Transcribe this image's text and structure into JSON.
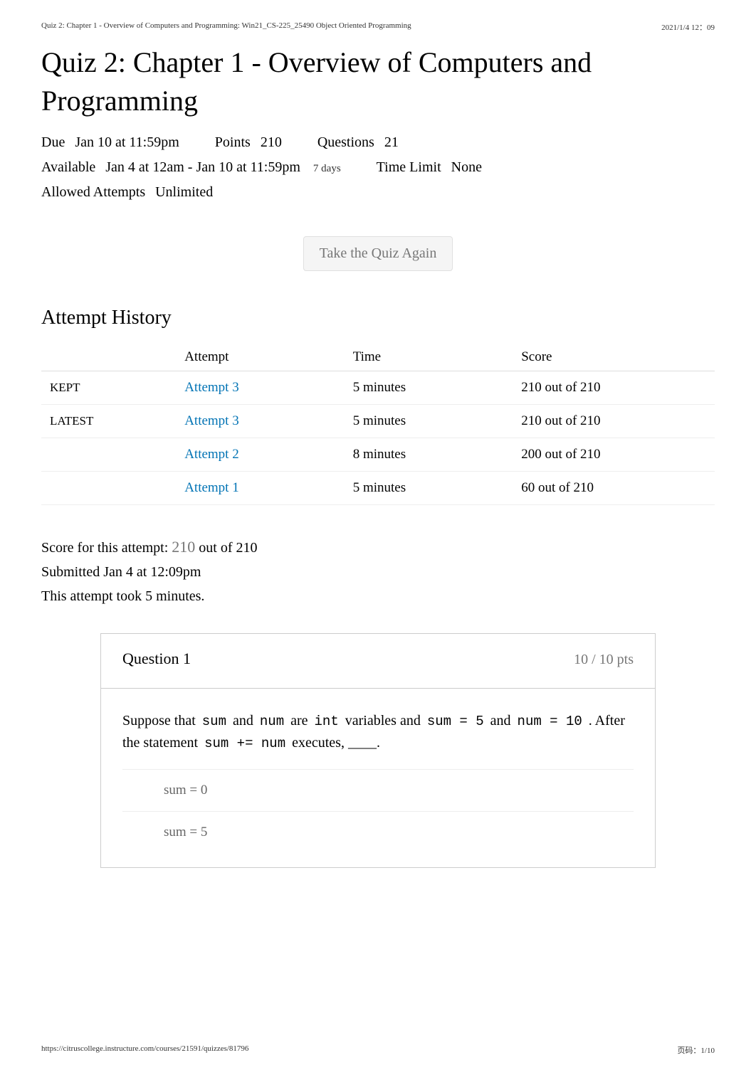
{
  "print_header": {
    "left": "Quiz 2: Chapter 1 - Overview of Computers and Programming: Win21_CS-225_25490 Object Oriented Programming",
    "right": "2021/1/4 12：09"
  },
  "title": "Quiz 2: Chapter 1 - Overview of Computers and Programming",
  "meta": {
    "due": {
      "label": "Due",
      "value": "Jan 10 at 11:59pm"
    },
    "points": {
      "label": "Points",
      "value": "210"
    },
    "questions": {
      "label": "Questions",
      "value": "21"
    },
    "available": {
      "label": "Available",
      "value": "Jan 4 at 12am - Jan 10 at 11:59pm",
      "aside": "7 days"
    },
    "time_limit": {
      "label": "Time Limit",
      "value": "None"
    },
    "allowed": {
      "label": "Allowed Attempts",
      "value": "Unlimited"
    }
  },
  "take_again": "Take the Quiz Again",
  "history": {
    "heading": "Attempt History",
    "cols": {
      "status": "",
      "attempt": "Attempt",
      "time": "Time",
      "score": "Score"
    },
    "rows": [
      {
        "status": "KEPT",
        "attempt": "Attempt 3",
        "time": "5 minutes",
        "score": "210 out of 210"
      },
      {
        "status": "LATEST",
        "attempt": "Attempt 3",
        "time": "5 minutes",
        "score": "210 out of 210"
      },
      {
        "status": "",
        "attempt": "Attempt 2",
        "time": "8 minutes",
        "score": "200 out of 210"
      },
      {
        "status": "",
        "attempt": "Attempt 1",
        "time": "5 minutes",
        "score": "60 out of 210"
      }
    ]
  },
  "summary": {
    "score_label": "Score for this attempt:",
    "score_value": "210",
    "score_suffix": "out of 210",
    "submitted": "Submitted Jan 4 at 12:09pm",
    "duration": "This attempt took 5 minutes."
  },
  "question": {
    "label": "Question 1",
    "points": "10 / 10 pts",
    "body": {
      "t1": "Suppose that ",
      "c1": "sum",
      "t2": " and ",
      "c2": "num",
      "t3": " are ",
      "c3": "int",
      "t4": " variables and ",
      "c4": "sum = 5",
      "t5": " and ",
      "c5": "num = 10",
      "t6": " . After the statement ",
      "c6": "sum += num",
      "t7": " executes, ____."
    },
    "answers": [
      {
        "text": "sum = 0"
      },
      {
        "text": "sum = 5"
      }
    ]
  },
  "print_footer": {
    "left": "https://citruscollege.instructure.com/courses/21591/quizzes/81796",
    "right": "页码：1/10"
  }
}
